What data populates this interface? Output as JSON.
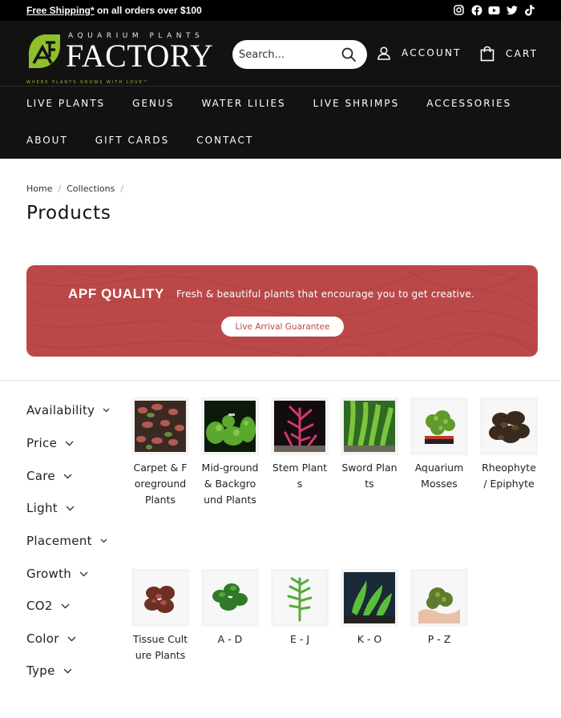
{
  "announcement": {
    "link_text": "Free Shipping*",
    "rest_text": " on all orders over $100"
  },
  "social": [
    "instagram-icon",
    "facebook-icon",
    "youtube-icon",
    "twitter-icon",
    "tiktok-icon"
  ],
  "logo": {
    "top": "AQUARIUM PLANTS",
    "main": "FACTORY",
    "tagline": "WHERE PLANTS GROWS WITH LOVE™",
    "accent": "#8fbf2a"
  },
  "search": {
    "placeholder": "Search..."
  },
  "header": {
    "account_label": "ACCOUNT",
    "cart_label": "CART"
  },
  "nav": {
    "row1": [
      "LIVE PLANTS",
      "GENUS",
      "WATER LILIES",
      "LIVE SHRIMPS",
      "ACCESSORIES"
    ],
    "row2": [
      "ABOUT",
      "GIFT CARDS",
      "CONTACT"
    ]
  },
  "breadcrumb": [
    "Home",
    "Collections"
  ],
  "page_title": "Products",
  "banner": {
    "heading": "APF QUALITY",
    "text": "Fresh & beautiful plants that encourage you to get creative.",
    "button": "Live Arrival Guarantee",
    "color": "#bb4848"
  },
  "filters": [
    "Availability",
    "Price",
    "Care",
    "Light",
    "Placement",
    "Growth",
    "CO2",
    "Color",
    "Type"
  ],
  "categories": [
    {
      "label": "Carpet & Foreground Plants"
    },
    {
      "label": "Mid-ground & Background Plants"
    },
    {
      "label": "Stem Plants"
    },
    {
      "label": "Sword Plants"
    },
    {
      "label": "Aquarium Mosses"
    },
    {
      "label": "Rheophyte / Epiphyte"
    },
    {
      "label": "Tissue Culture Plants"
    },
    {
      "label": "A - D"
    },
    {
      "label": "E - J"
    },
    {
      "label": "K - O"
    },
    {
      "label": "P - Z"
    }
  ]
}
